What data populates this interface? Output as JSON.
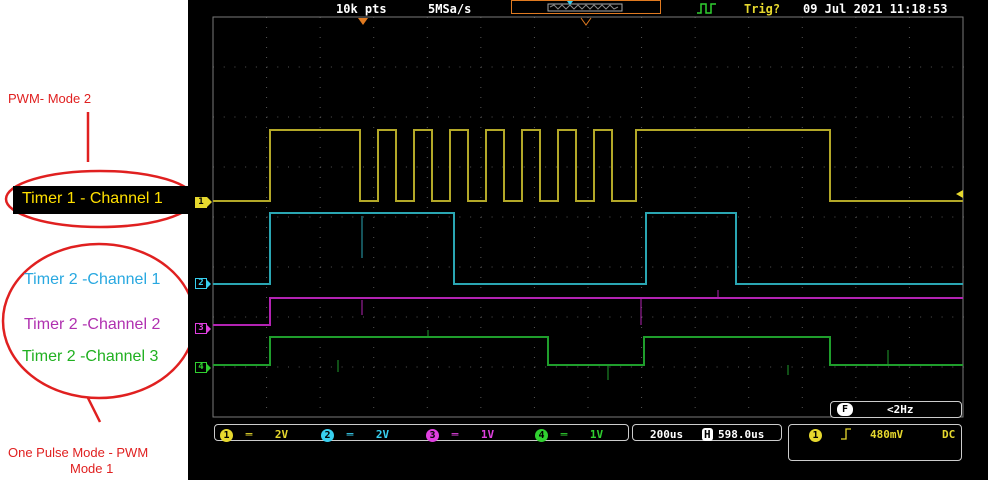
{
  "annotations": {
    "pwm_mode2": "PWM- Mode 2",
    "timer1_ch1": "Timer 1 - Channel 1",
    "timer2_ch1": "Timer 2 -Channel 1",
    "timer2_ch2": "Timer 2 -Channel 2",
    "timer2_ch3": "Timer 2 -Channel 3",
    "one_pulse_line1": "One Pulse Mode - PWM",
    "one_pulse_line2": "Mode 1"
  },
  "header": {
    "points": "10k pts",
    "sample_rate": "5MSa/s",
    "trig_status": "Trig?",
    "datetime": "09 Jul 2021 11:18:53"
  },
  "channels": [
    {
      "num": "1",
      "scale": "2V",
      "color": "#e6d82e",
      "trace": "#b3a828"
    },
    {
      "num": "2",
      "scale": "2V",
      "color": "#38d0f0",
      "trace": "#2aa6b3"
    },
    {
      "num": "3",
      "scale": "1V",
      "color": "#e040e0",
      "trace": "#b323b3"
    },
    {
      "num": "4",
      "scale": "1V",
      "color": "#30d030",
      "trace": "#1f9e2c"
    }
  ],
  "timebase": {
    "scale": "200us",
    "position": "598.0us",
    "h_icon": "H"
  },
  "trigger": {
    "source": "1",
    "level": "480mV",
    "coupling": "DC",
    "freq_badge": "F",
    "freq": "<2Hz"
  }
}
